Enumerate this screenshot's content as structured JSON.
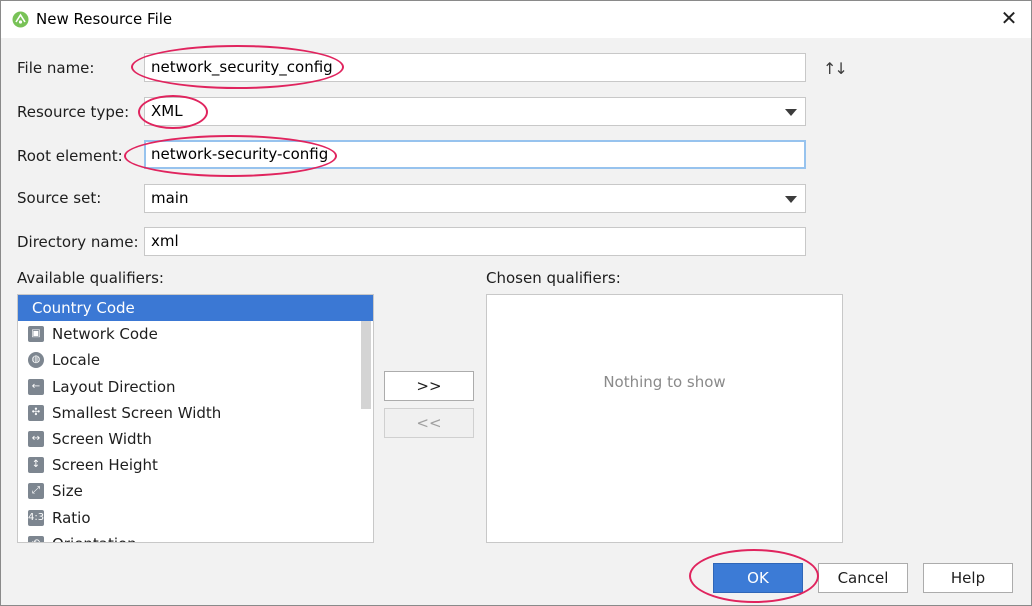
{
  "window": {
    "title": "New Resource File",
    "close_glyph": "✕"
  },
  "form": {
    "file_name": {
      "label": "File name:",
      "value": "network_security_config"
    },
    "resource_type": {
      "label": "Resource type:",
      "value": "XML"
    },
    "root_element": {
      "label": "Root element:",
      "value": "network-security-config"
    },
    "source_set": {
      "label": "Source set:",
      "value": "main"
    },
    "directory_name": {
      "label": "Directory name:",
      "value": "xml"
    }
  },
  "qualifiers": {
    "available_label": "Available qualifiers:",
    "chosen_label": "Chosen qualifiers:",
    "available": [
      {
        "label": "Country Code",
        "icon": "country-code-icon",
        "selected": true
      },
      {
        "label": "Network Code",
        "icon": "network-code-icon"
      },
      {
        "label": "Locale",
        "icon": "globe-icon"
      },
      {
        "label": "Layout Direction",
        "icon": "layout-direction-icon"
      },
      {
        "label": "Smallest Screen Width",
        "icon": "smallest-width-icon"
      },
      {
        "label": "Screen Width",
        "icon": "screen-width-icon"
      },
      {
        "label": "Screen Height",
        "icon": "screen-height-icon"
      },
      {
        "label": "Size",
        "icon": "size-icon"
      },
      {
        "label": "Ratio",
        "icon": "ratio-icon"
      },
      {
        "label": "Orientation",
        "icon": "orientation-icon"
      }
    ],
    "add_label": ">>",
    "remove_label": "<<",
    "chosen_empty": "Nothing to show"
  },
  "buttons": {
    "ok": "OK",
    "cancel": "Cancel",
    "help": "Help"
  },
  "colors": {
    "accent": "#3b78d4",
    "annotation": "#e0245e",
    "focus": "#97c3ee"
  }
}
